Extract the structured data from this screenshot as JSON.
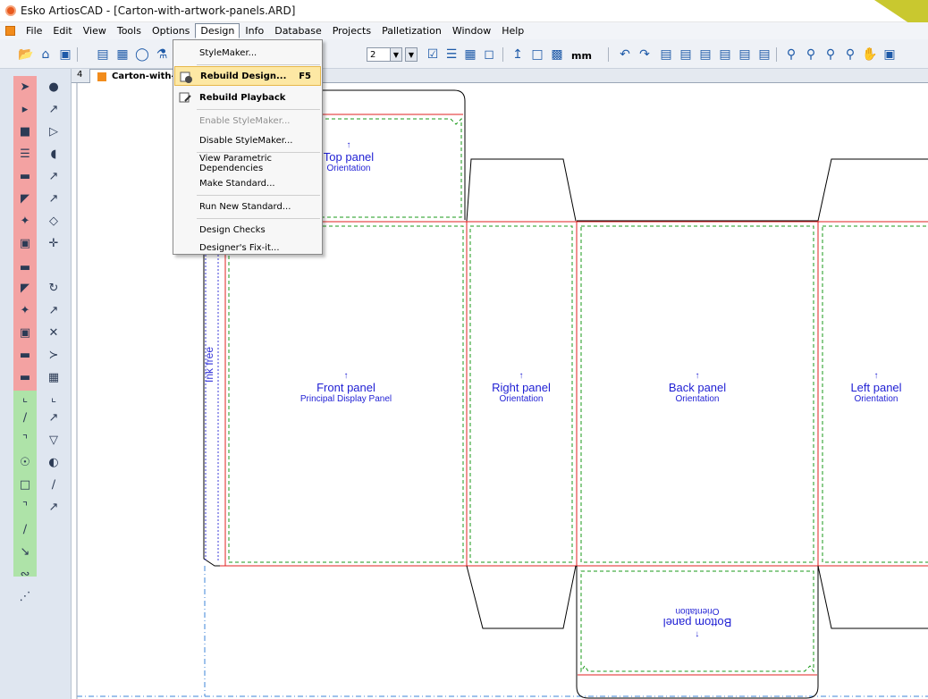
{
  "window": {
    "title": "Esko ArtiosCAD - [Carton-with-artwork-panels.ARD]"
  },
  "menubar": {
    "items": [
      "File",
      "Edit",
      "View",
      "Tools",
      "Options",
      "Design",
      "Info",
      "Database",
      "Projects",
      "Palletization",
      "Window",
      "Help"
    ],
    "active": "Design"
  },
  "toolbar": {
    "combo1_value": "2",
    "units": "mm"
  },
  "tab": {
    "label": "Carton-with-artwork-panels.ARD",
    "nav_glyph": "4"
  },
  "design_menu": {
    "items": [
      {
        "label": "StyleMaker...",
        "shortcut": "",
        "disabled": false
      },
      {
        "label": "Rebuild Design...",
        "shortcut": "F5",
        "disabled": false,
        "highlighted": true
      },
      {
        "label": "Rebuild Playback",
        "shortcut": "",
        "disabled": false
      },
      {
        "label": "Enable StyleMaker...",
        "shortcut": "",
        "disabled": true
      },
      {
        "label": "Disable StyleMaker...",
        "shortcut": "",
        "disabled": false
      },
      {
        "label": "View Parametric Dependencies",
        "shortcut": "",
        "disabled": false
      },
      {
        "label": "Make Standard...",
        "shortcut": "",
        "disabled": false
      },
      {
        "label": "Run New Standard...",
        "shortcut": "",
        "disabled": false
      },
      {
        "label": "Design Checks",
        "shortcut": "",
        "disabled": false
      },
      {
        "label": "Designer's Fix-it...",
        "shortcut": "",
        "disabled": false
      }
    ]
  },
  "canvas": {
    "ink_free": "Ink free",
    "panels": {
      "top": {
        "title": "Top panel",
        "subtitle": "Orientation"
      },
      "front": {
        "title": "Front panel",
        "subtitle": "Principal Display Panel"
      },
      "right": {
        "title": "Right panel",
        "subtitle": "Orientation"
      },
      "back": {
        "title": "Back panel",
        "subtitle": "Orientation"
      },
      "left": {
        "title": "Left panel",
        "subtitle": "Orientation"
      },
      "bottom": {
        "title": "Bottom panel",
        "subtitle": "Orientation"
      }
    }
  },
  "colors": {
    "cut": "#000000",
    "crease": "#e02020",
    "bleed": "#1a9a1a",
    "text": "#1f1fd4",
    "tool_red": "#f3a2a2",
    "tool_green": "#aee3a8"
  }
}
